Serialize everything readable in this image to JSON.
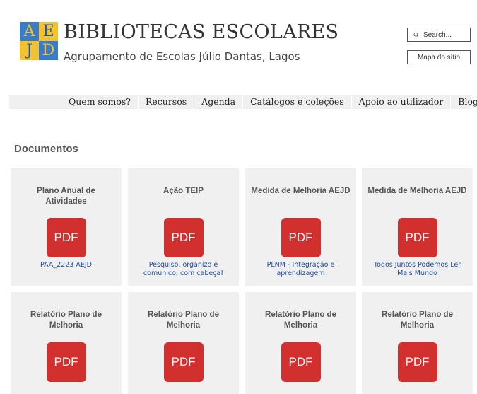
{
  "logo": {
    "letters": [
      "A",
      "E",
      "J",
      "D"
    ]
  },
  "header": {
    "title": "BIBLIOTECAS ESCOLARES",
    "subtitle": "Agrupamento de Escolas Júlio Dantas, Lagos"
  },
  "search": {
    "placeholder": "Search..."
  },
  "sitemap_label": "Mapa do sítio",
  "nav": [
    "Quem somos?",
    "Recursos",
    "Agenda",
    "Catálogos e coleções",
    "Apoio ao utilizador",
    "Blogue"
  ],
  "section_title": "Documentos",
  "cards": [
    {
      "title": "Plano Anual de Atividades",
      "icon": "PDF",
      "link": "PAA_2223 AEJD"
    },
    {
      "title": "Ação TEIP",
      "icon": "PDF",
      "link": "Pesquiso, organizo e comunico, com cabeça!"
    },
    {
      "title": "Medida de Melhoria AEJD",
      "icon": "PDF",
      "link": "PLNM - Integração e aprendizagem"
    },
    {
      "title": "Medida de Melhoria AEJD",
      "icon": "PDF",
      "link": "Todos Juntos Podemos Ler Mais Mundo"
    },
    {
      "title": "Relatório Plano de Melhoria",
      "icon": "PDF",
      "link": ""
    },
    {
      "title": "Relatório Plano de Melhoria",
      "icon": "PDF",
      "link": ""
    },
    {
      "title": "Relatório Plano de Melhoria",
      "icon": "PDF",
      "link": ""
    },
    {
      "title": "Relatório Plano de Melhoria",
      "icon": "PDF",
      "link": ""
    }
  ]
}
